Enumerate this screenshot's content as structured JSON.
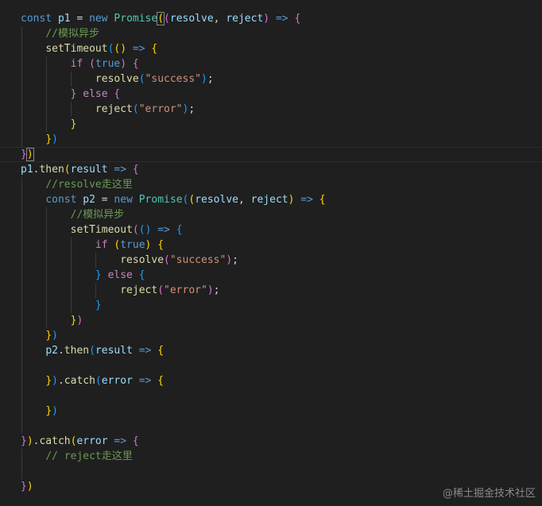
{
  "editor": {
    "comment_async": "//模拟异步",
    "comment_resolve": "//resolve走这里",
    "comment_reject": "// reject走这里",
    "str_success": "\"success\"",
    "str_error": "\"error\""
  },
  "watermark": "@稀土掘金技术社区"
}
